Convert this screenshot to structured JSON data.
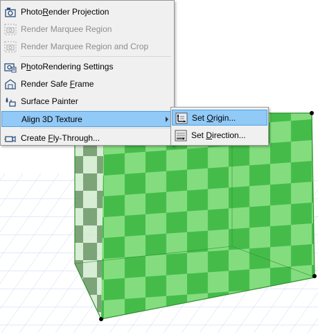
{
  "main_menu": {
    "items": [
      {
        "label_pre": "Photo",
        "label_u": "R",
        "label_post": "ender Projection",
        "icon": "camera-render-icon",
        "enabled": true
      },
      {
        "label_pre": "Render Marquee Region",
        "label_u": "",
        "label_post": "",
        "icon": "marquee-camera-icon",
        "enabled": false
      },
      {
        "label_pre": "Render Marquee Region and Crop",
        "label_u": "",
        "label_post": "",
        "icon": "marquee-crop-icon",
        "enabled": false
      },
      {
        "label_pre": "P",
        "label_u": "h",
        "label_post": "otoRendering Settings",
        "icon": "render-settings-icon",
        "enabled": true
      },
      {
        "label_pre": "Render Safe ",
        "label_u": "F",
        "label_post": "rame",
        "icon": "safe-frame-icon",
        "enabled": true
      },
      {
        "label_pre": "Surface Painter",
        "label_u": "",
        "label_post": "",
        "icon": "surface-painter-icon",
        "enabled": true
      },
      {
        "label_pre": "Align 3D Texture",
        "label_u": "",
        "label_post": "",
        "icon": "",
        "enabled": true
      },
      {
        "label_pre": "Create ",
        "label_u": "F",
        "label_post": "ly-Through...",
        "icon": "fly-through-icon",
        "enabled": true
      }
    ]
  },
  "sub_menu": {
    "items": [
      {
        "label_pre": "Set ",
        "label_u": "O",
        "label_post": "rigin...",
        "icon": "set-origin-icon"
      },
      {
        "label_pre": "Set ",
        "label_u": "D",
        "label_post": "irection...",
        "icon": "set-direction-icon"
      }
    ]
  },
  "colors": {
    "checker_light": "#8fe08a",
    "checker_dark": "#3cb444",
    "highlight": "#91c9f7",
    "grid": "#c8d6ee"
  }
}
